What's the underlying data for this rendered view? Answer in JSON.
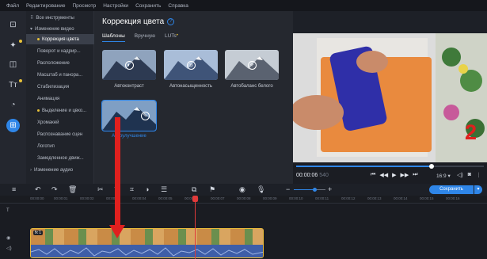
{
  "menu": [
    "Файл",
    "Редактирование",
    "Просмотр",
    "Настройки",
    "Сохранить",
    "Справка"
  ],
  "tools": {
    "all_tools": "Все инструменты",
    "items": [
      {
        "label": "Изменение видео",
        "kind": "head"
      },
      {
        "label": "Коррекция цвета",
        "kind": "sel"
      },
      {
        "label": "Поворот и кадрир...",
        "kind": "item"
      },
      {
        "label": "Расположение",
        "kind": "item"
      },
      {
        "label": "Масштаб и панора...",
        "kind": "item"
      },
      {
        "label": "Стабилизация",
        "kind": "item"
      },
      {
        "label": "Анимация",
        "kind": "item"
      },
      {
        "label": "Выделение и цвко...",
        "kind": "item"
      },
      {
        "label": "Хромакей",
        "kind": "item"
      },
      {
        "label": "Распознавание сцен",
        "kind": "item"
      },
      {
        "label": "Логотип",
        "kind": "item"
      },
      {
        "label": "Замедленное движ...",
        "kind": "item"
      },
      {
        "label": "Изменение аудио",
        "kind": "head"
      }
    ]
  },
  "panel": {
    "title": "Коррекция цвета",
    "tabs": [
      "Шаблоны",
      "Вручную",
      "LUTs"
    ],
    "presets": [
      "Автоконтраст",
      "Автонасыщенность",
      "Автобаланс белого",
      "Автоулучшение"
    ]
  },
  "player": {
    "time": "00:00:06",
    "frames": "540",
    "ratio": "16:9",
    "progress": 0.72
  },
  "timeline": {
    "save_label": "Сохранить",
    "ruler": [
      "00:00:00",
      "00:00:01",
      "00:00:02",
      "00:00:03",
      "00:00:04",
      "00:00:05",
      "00:00:06",
      "00:00:07",
      "00:00:08",
      "00:00:09",
      "00:00:10",
      "00:00:11",
      "00:00:12",
      "00:00:13",
      "00:00:14",
      "00:00:15",
      "00:00:16"
    ],
    "clip_fx": "fx 1"
  },
  "annotation": {
    "number": "2"
  },
  "colors": {
    "accent": "#2f86e8",
    "arrow": "#e0201e",
    "clip_border": "#e8b93a"
  }
}
